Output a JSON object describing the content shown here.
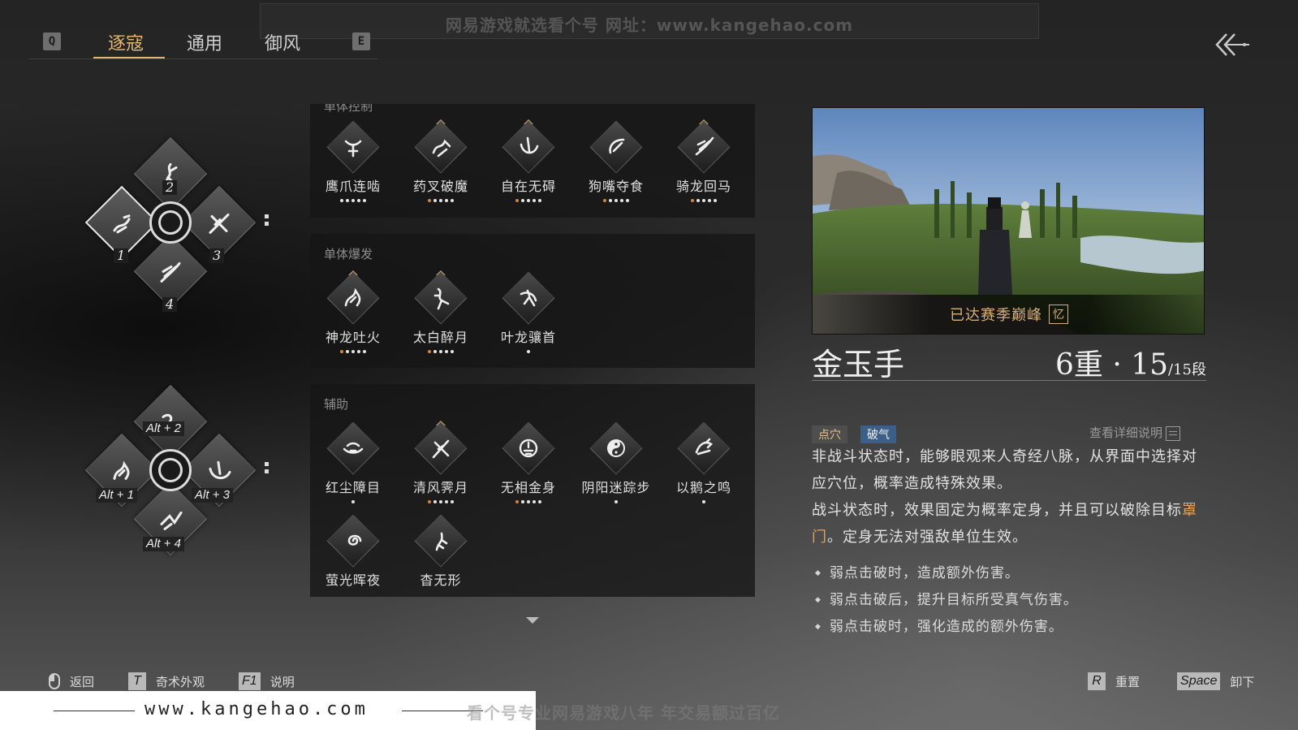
{
  "watermark": {
    "top_text": "网易游戏就选看个号   网址：www.kangehao.com",
    "bottom_url": "www.kangehao.com",
    "bottom_text": "看个号专业网易游戏八年  年交易额过百亿"
  },
  "tabs": {
    "prev_key": "Q",
    "next_key": "E",
    "items": [
      {
        "label": "逐寇",
        "active": true
      },
      {
        "label": "通用",
        "active": false
      },
      {
        "label": "御风",
        "active": false
      }
    ]
  },
  "loadout": {
    "set1": {
      "labels": [
        "2",
        "1",
        "3",
        "4"
      ]
    },
    "set2": {
      "labels": [
        "Alt + 2",
        "Alt + 1",
        "Alt + 3",
        "Alt + 4"
      ]
    }
  },
  "sections": [
    {
      "title": "单体控制",
      "skills": [
        {
          "name": "鹰爪连啮",
          "tri": false,
          "pips": [
            "w",
            "w",
            "w",
            "w",
            "w"
          ]
        },
        {
          "name": "药叉破魔",
          "tri": true,
          "pips": [
            "o",
            "w",
            "w",
            "w",
            "w"
          ]
        },
        {
          "name": "自在无碍",
          "tri": true,
          "pips": [
            "o",
            "w",
            "w",
            "w",
            "w"
          ]
        },
        {
          "name": "狗嘴夺食",
          "tri": false,
          "pips": [
            "o",
            "w",
            "w",
            "w",
            "w"
          ]
        },
        {
          "name": "骑龙回马",
          "tri": true,
          "pips": [
            "o",
            "w",
            "w",
            "w",
            "w"
          ]
        }
      ]
    },
    {
      "title": "单体爆发",
      "skills": [
        {
          "name": "神龙吐火",
          "tri": true,
          "pips": [
            "o",
            "w",
            "w",
            "w",
            "w"
          ]
        },
        {
          "name": "太白醉月",
          "tri": true,
          "pips": [
            "o",
            "w",
            "w",
            "w",
            "w"
          ]
        },
        {
          "name": "叶龙骧首",
          "tri": false,
          "pips": [
            "w"
          ]
        }
      ]
    },
    {
      "title": "辅助",
      "skills": [
        {
          "name": "红尘障目",
          "tri": false,
          "pips": [
            "w"
          ]
        },
        {
          "name": "清风霁月",
          "tri": true,
          "pips": [
            "o",
            "w",
            "w",
            "w",
            "w"
          ]
        },
        {
          "name": "无相金身",
          "tri": false,
          "pips": [
            "o",
            "w",
            "w",
            "w",
            "w"
          ]
        },
        {
          "name": "阴阳迷踪步",
          "tri": false,
          "pips": [
            "w"
          ]
        },
        {
          "name": "以鹅之鸣",
          "tri": false,
          "pips": [
            "w"
          ]
        },
        {
          "name": "萤光晖夜",
          "tri": false,
          "pips": []
        },
        {
          "name": "杳无形",
          "tri": false,
          "pips": []
        }
      ]
    }
  ],
  "detail": {
    "season_text": "已达赛季巅峰",
    "season_badge": "忆",
    "name": "金玉手",
    "level_main": "6重 · 15",
    "level_sub": "/15段",
    "tags": [
      "点穴",
      "破气"
    ],
    "detail_link": "查看详细说明",
    "desc_line1": "非战斗状态时，能够眼观来人奇经八脉，从界面中选择对应穴位，概率造成特殊效果。",
    "desc_line2_a": "战斗状态时，效果固定为概率定身，并且可以破除目标",
    "desc_line2_hl": "罩门",
    "desc_line2_b": "。定身无法对强敌单位生效。",
    "bullets": [
      "弱点击破时，造成额外伤害。",
      "弱点击破后，提升目标所受真气伤害。",
      "弱点击破时，强化造成的额外伤害。"
    ]
  },
  "footer": {
    "back_label": "返回",
    "t_key": "T",
    "t_label": "奇术外观",
    "f1_key": "F1",
    "f1_label": "说明",
    "r_key": "R",
    "r_label": "重置",
    "space_key": "Space",
    "space_label": "卸下"
  },
  "colors": {
    "accent": "#e3b56f",
    "highlight": "#e3a25e",
    "tag_blue": "#3b5f86"
  }
}
